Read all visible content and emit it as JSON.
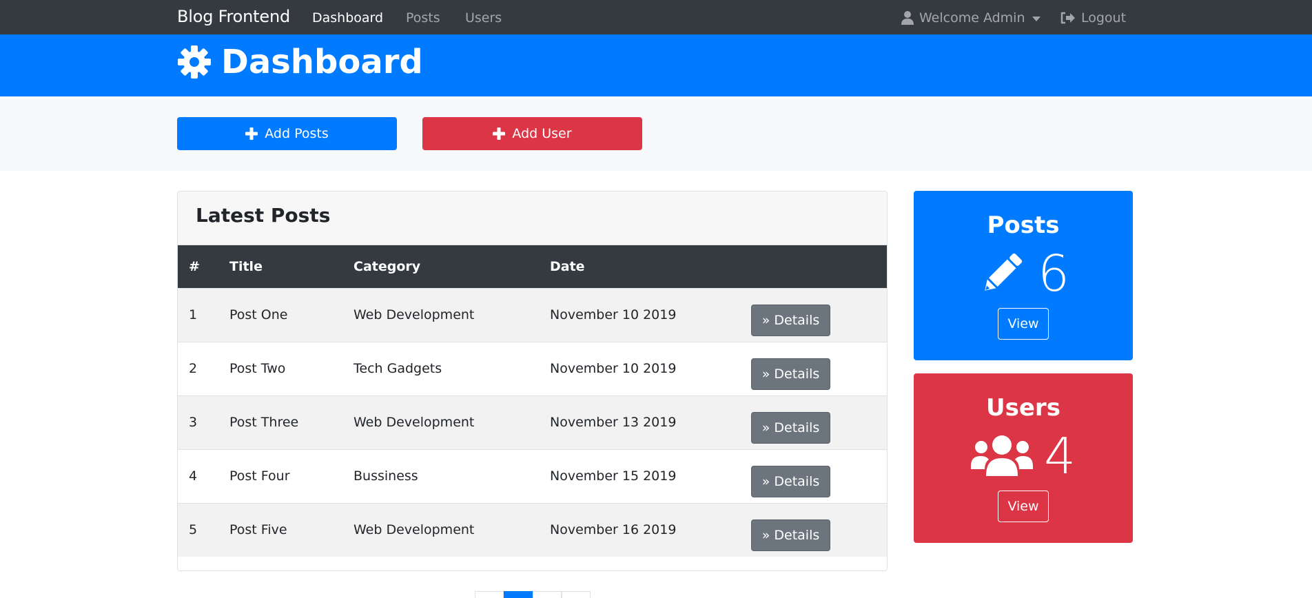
{
  "navbar": {
    "brand": "Blog Frontend",
    "links": [
      {
        "label": "Dashboard",
        "active": true
      },
      {
        "label": "Posts",
        "active": false
      },
      {
        "label": "Users",
        "active": false
      }
    ],
    "welcome": "Welcome Admin",
    "logout": "Logout",
    "icons": {
      "user": "user-icon",
      "logout": "sign-out-icon"
    }
  },
  "header": {
    "title": "Dashboard",
    "icon": "gear-icon"
  },
  "actions": {
    "add_posts": "Add Posts",
    "add_user": "Add User"
  },
  "posts_table": {
    "title": "Latest Posts",
    "columns": [
      "#",
      "Title",
      "Category",
      "Date"
    ],
    "rows": [
      {
        "num": "1",
        "title": "Post One",
        "category": "Web Development",
        "date": "November 10 2019",
        "action": "Details"
      },
      {
        "num": "2",
        "title": "Post Two",
        "category": "Tech Gadgets",
        "date": "November 10 2019",
        "action": "Details"
      },
      {
        "num": "3",
        "title": "Post Three",
        "category": "Web Development",
        "date": "November 13 2019",
        "action": "Details"
      },
      {
        "num": "4",
        "title": "Post Four",
        "category": "Bussiness",
        "date": "November 15 2019",
        "action": "Details"
      },
      {
        "num": "5",
        "title": "Post Five",
        "category": "Web Development",
        "date": "November 16 2019",
        "action": "Details"
      }
    ]
  },
  "stats": {
    "posts": {
      "title": "Posts",
      "count": "6",
      "button": "View",
      "icon": "pencil-icon"
    },
    "users": {
      "title": "Users",
      "count": "4",
      "button": "View",
      "icon": "users-icon"
    }
  },
  "colors": {
    "primary": "#007bff",
    "danger": "#dc3545",
    "dark": "#343a40",
    "secondary": "#6c757d",
    "light": "#f8f9fa"
  }
}
